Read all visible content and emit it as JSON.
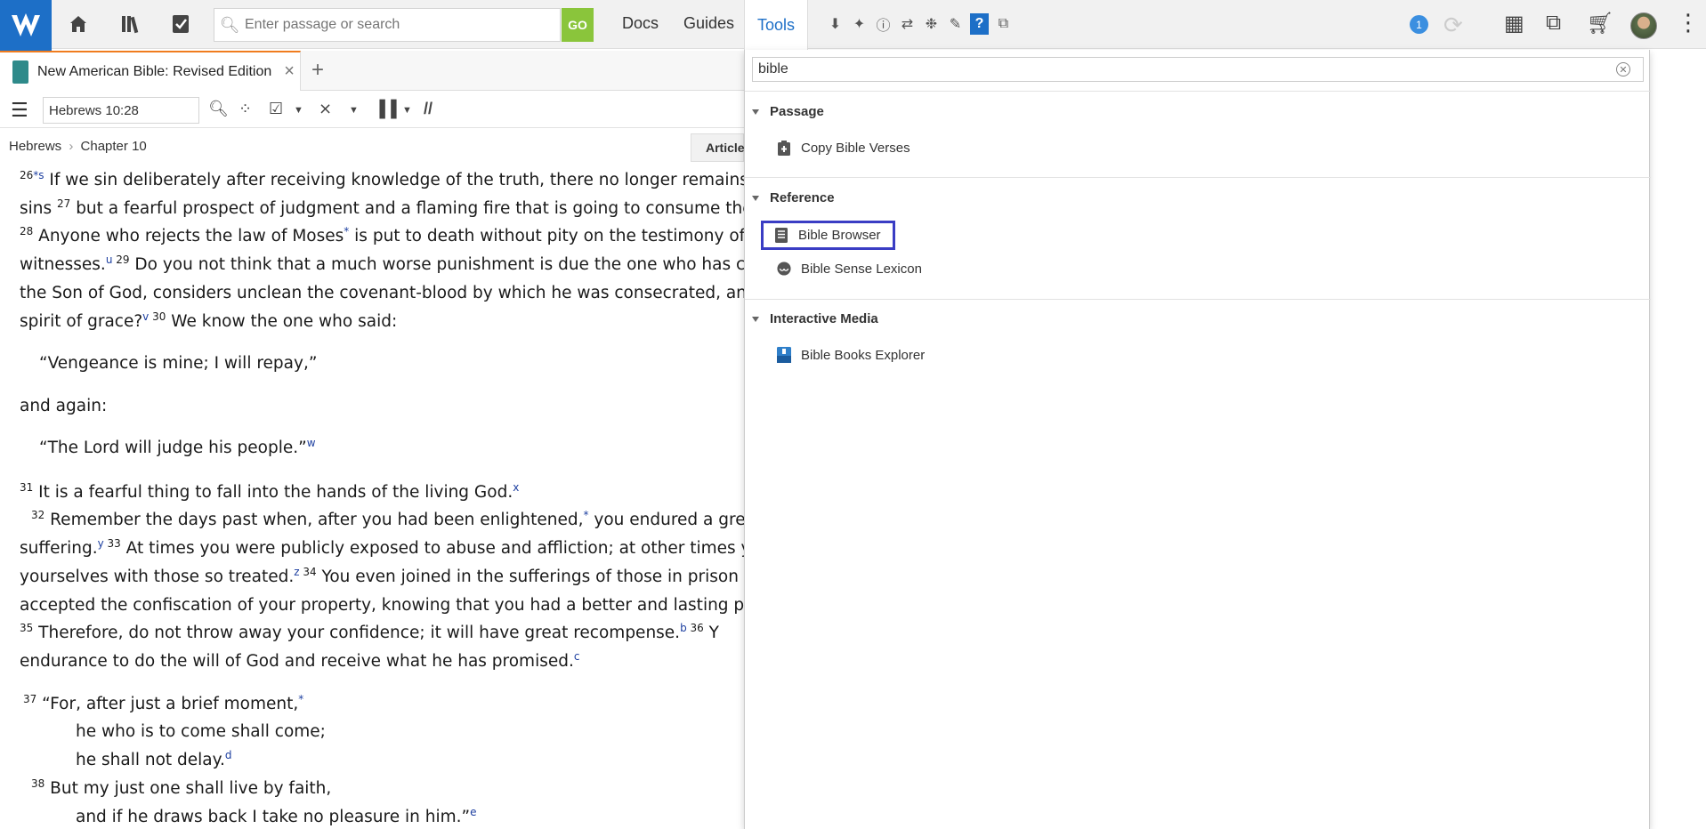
{
  "topbar": {
    "search_placeholder": "Enter passage or search",
    "go_label": "GO",
    "nav": [
      "Docs",
      "Guides",
      "Tools"
    ],
    "notification_count": "1"
  },
  "tab": {
    "title": "New American Bible: Revised Edition",
    "close": "×",
    "add": "+"
  },
  "toolbar": {
    "reference": "Hebrews 10:28",
    "parallel_label": "//"
  },
  "breadcrumb": {
    "book": "Hebrews",
    "sep": "›",
    "chapter": "Chapter 10",
    "article_label": "Article"
  },
  "bible_text": {
    "l1": {
      "v1": "26",
      "n1": "*s",
      "t1": " If we sin deliberately after receiving knowledge of the truth, there no longer remains sac"
    },
    "l2": {
      "t0": "sins ",
      "v1": "27",
      "t1": " but a fearful prospect of judgment and a flaming fire that is going to consume the adv"
    },
    "l3": {
      "v1": "28",
      "t1": " Anyone who rejects the law of Moses",
      "n1": "*",
      "t2": " is put to death without pity on the testimony of two"
    },
    "l4": {
      "t0": "witnesses.",
      "n1": "u",
      "v1": " 29",
      "t1": " Do you not think that a much worse punishment is due the one who has cont"
    },
    "l5": {
      "t0": "the Son of God, considers unclean the covenant-blood by which he was consecrated, and in"
    },
    "l6": {
      "t0": "spirit of grace?",
      "n1": "v",
      "v1": " 30",
      "t1": " We know the one who said:"
    },
    "l7": {
      "t0": "“Vengeance is mine; I will repay,”"
    },
    "l8": {
      "t0": "and again:"
    },
    "l9": {
      "t0": "“The Lord will judge his people.”",
      "n1": "w"
    },
    "l10": {
      "v1": "31",
      "t1": " It is a fearful thing to fall into the hands of the living God.",
      "n1": "x"
    },
    "l11": {
      "v1": "32",
      "t1": " Remember the days past when, after you had been enlightened,",
      "n1": "*",
      "t2": " you endured a great c"
    },
    "l12": {
      "t0": "suffering.",
      "n1": "y",
      "v1": " 33",
      "t1": " At times you were publicly exposed to abuse and affliction; at other times you a"
    },
    "l13": {
      "t0": "yourselves with those so treated.",
      "n1": "z",
      "v1": " 34",
      "t1": " You even joined in the sufferings of those in prison and"
    },
    "l14": {
      "t0": "accepted the confiscation of your property, knowing that you had a better and lasting pos"
    },
    "l15": {
      "v1": "35",
      "t1": " Therefore, do not throw away your confidence; it will have great recompense.",
      "n1": "b",
      "v2": " 36",
      "t2": " Y"
    },
    "l16": {
      "t0": "endurance to do the will of God and receive what he has promised.",
      "n1": "c"
    },
    "l17": {
      "v1": "37",
      "t1": " “For, after just a brief moment,",
      "n1": "*"
    },
    "l18": {
      "t0": "he who is to come shall come;"
    },
    "l19": {
      "t0": "he shall not delay.",
      "n1": "d"
    },
    "l20": {
      "v1": "38",
      "t1": " But my just one shall live by faith,"
    },
    "l21": {
      "t0": "and if he draws back I take no pleasure in him.”",
      "n1": "e"
    }
  },
  "tools_panel": {
    "filter_value": "bible",
    "sections": [
      {
        "title": "Passage",
        "items": [
          "Copy Bible Verses"
        ]
      },
      {
        "title": "Reference",
        "items": [
          "Bible Browser",
          "Bible Sense Lexicon"
        ]
      },
      {
        "title": "Interactive Media",
        "items": [
          "Bible Books Explorer"
        ]
      }
    ],
    "highlighted_item": "Bible Browser"
  },
  "colors": {
    "brand_blue": "#1d6fc7",
    "go_green": "#8ac53b",
    "tab_accent": "#f07c1e",
    "highlight": "#3a3dc4",
    "footnote": "#1d3fa0"
  }
}
